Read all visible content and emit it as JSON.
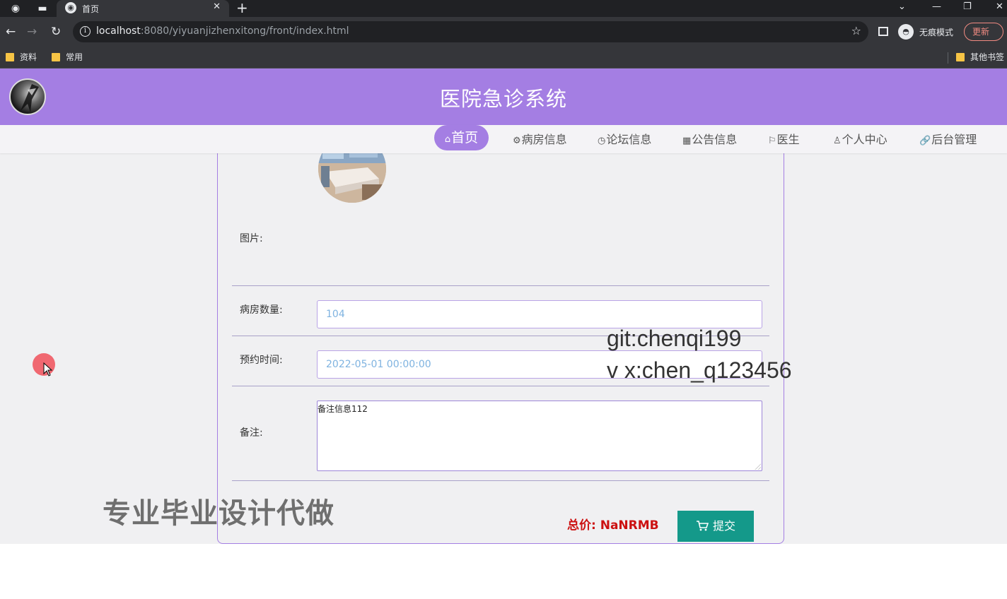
{
  "browser": {
    "tab_title": "首页",
    "url_host": "localhost",
    "url_rest": ":8080/yiyuanjizhenxitong/front/index.html",
    "incognito_label": "无痕模式",
    "update_label": "更新",
    "bookmarks": [
      "资料",
      "常用"
    ],
    "other_bookmarks": "其他书签"
  },
  "site": {
    "title": "医院急诊系统"
  },
  "menu": {
    "items": [
      {
        "icon": "⌂",
        "label": "首页"
      },
      {
        "icon": "⚙",
        "label": "病房信息"
      },
      {
        "icon": "◷",
        "label": "论坛信息"
      },
      {
        "icon": "▦",
        "label": "公告信息"
      },
      {
        "icon": "⚐",
        "label": "医生"
      },
      {
        "icon": "♙",
        "label": "个人中心"
      },
      {
        "icon": "🔗",
        "label": "后台管理"
      }
    ]
  },
  "form": {
    "image_label": "图片:",
    "room_count_label": "病房数量:",
    "room_count_value": "104",
    "appointment_label": "预约时间:",
    "appointment_value": "2022-05-01 00:00:00",
    "notes_label": "备注:",
    "notes_value": "备注信息112",
    "total_text": "总价: NaNRMB",
    "submit_label": "提交"
  },
  "watermarks": {
    "line1": "git:chenqi199",
    "line2": "v x:chen_q123456",
    "big": "专业毕业设计代做"
  },
  "colors": {
    "header": "#a47ee3",
    "submit": "#14998a",
    "total": "#cc1111"
  }
}
